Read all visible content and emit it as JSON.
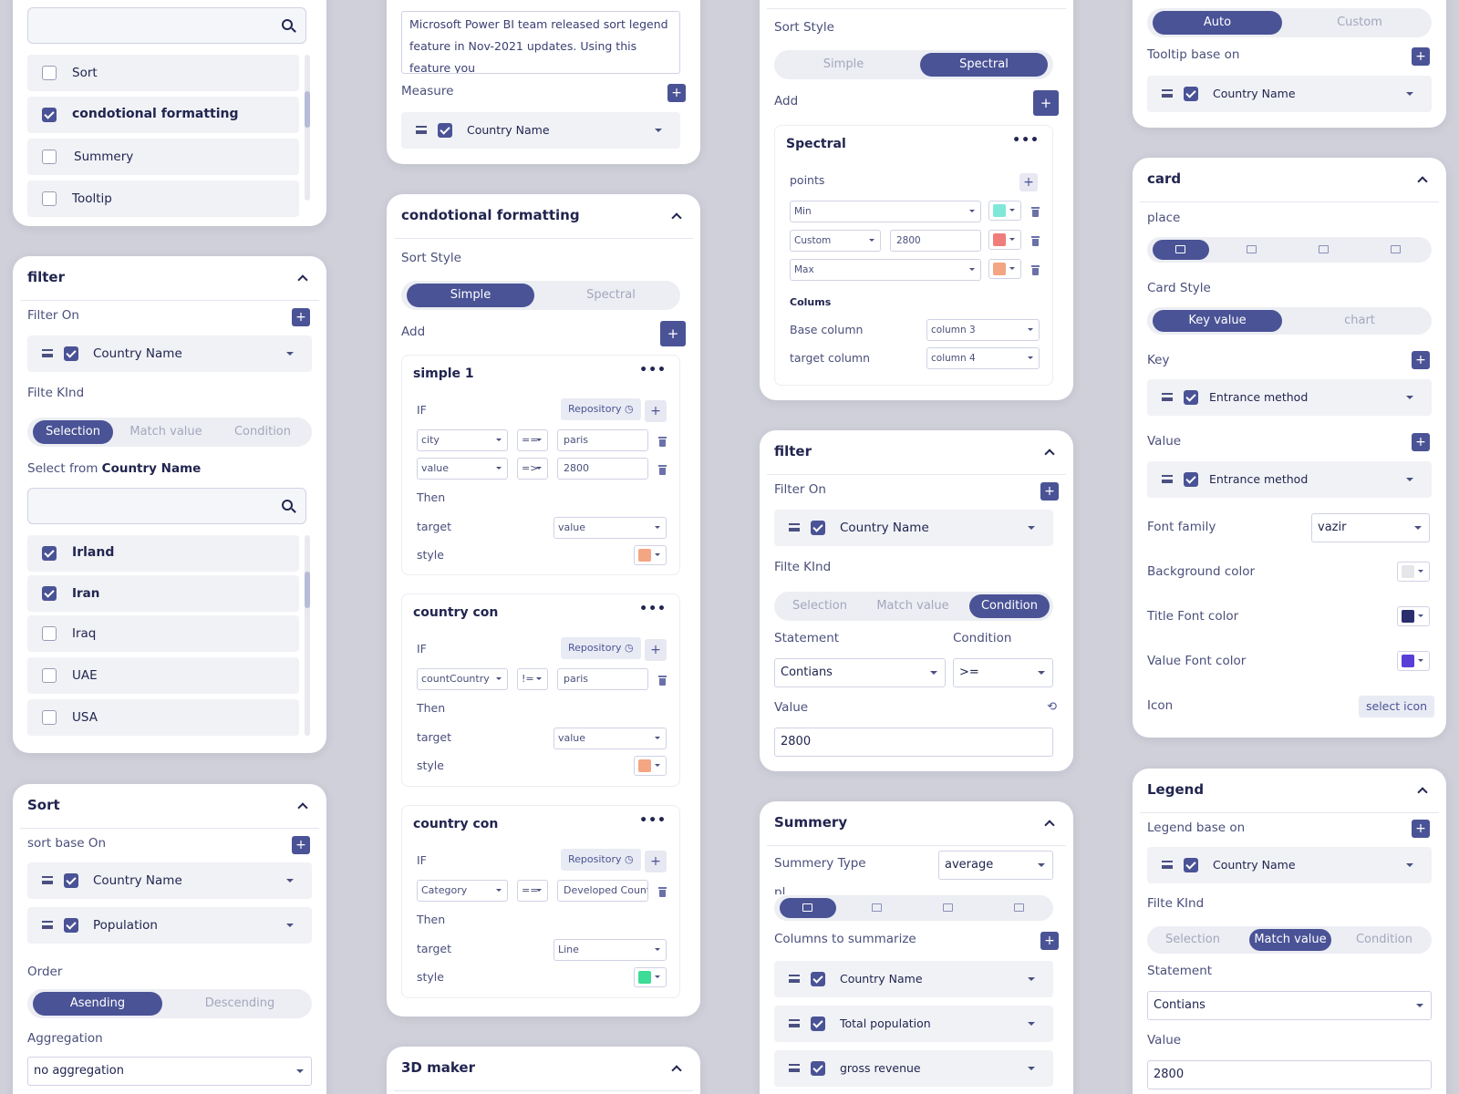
{
  "c1": {
    "search_placeholder": "",
    "items": [
      {
        "label": "Sort",
        "checked": false
      },
      {
        "label": "condotional formatting",
        "checked": true
      },
      {
        "label": "Summery",
        "checked": false
      },
      {
        "label": "Tooltip",
        "checked": false
      }
    ]
  },
  "c2": {
    "title": "filter",
    "filter_on": "Filter On",
    "field": "Country Name",
    "filte_kind": "Filte KInd",
    "kind_options": [
      "Selection",
      "Match value",
      "Condition"
    ],
    "select_from_prefix": "Select from ",
    "select_from_field": "Country Name",
    "search_placeholder": "",
    "countries": [
      {
        "label": "Irland",
        "checked": true
      },
      {
        "label": "Iran",
        "checked": true
      },
      {
        "label": "Iraq",
        "checked": false
      },
      {
        "label": "UAE",
        "checked": false
      },
      {
        "label": "USA",
        "checked": false
      }
    ]
  },
  "c3": {
    "title": "Sort",
    "sort_base": "sort base  On",
    "fields": [
      "Country Name",
      "Population"
    ],
    "order": "Order",
    "order_options": [
      "Asending",
      "Descending"
    ],
    "aggregation": "Aggregation",
    "aggregation_value": "no aggregation"
  },
  "c4": {
    "text": "Microsoft Power BI team released sort legend feature in Nov-2021 updates. Using this feature you",
    "measure": "Measure",
    "field": "Country Name"
  },
  "c5": {
    "title": "condotional formatting",
    "sort_style": "Sort Style",
    "style_options": [
      "Simple",
      "Spectral"
    ],
    "add": "Add",
    "if_label": "IF",
    "then_label": "Then",
    "target_label": "target",
    "style_label": "style",
    "repo_label": "Repository",
    "rules": [
      {
        "title": "simple 1",
        "conds": [
          {
            "field": "city",
            "op": "==",
            "val": "paris"
          },
          {
            "field": "value",
            "op": "=>",
            "val": "2800"
          }
        ],
        "target": "value",
        "color": "#f4a582"
      },
      {
        "title": "country con",
        "conds": [
          {
            "field": "countCountry",
            "op": "!=",
            "val": "paris"
          }
        ],
        "target": "value",
        "color": "#f4a582"
      },
      {
        "title": "country con",
        "conds": [
          {
            "field": "Category",
            "op": "==",
            "val": "Developed Countr"
          }
        ],
        "target": "Line",
        "color": "#3ddc97"
      }
    ]
  },
  "c6": {
    "title": "3D maker"
  },
  "c7": {
    "sort_style": "Sort Style",
    "style_options": [
      "Simple",
      "Spectral"
    ],
    "add": "Add",
    "spectral_title": "Spectral",
    "points": "points",
    "point_rows": [
      {
        "type": "Min",
        "value": "",
        "color": "#7fe8d8"
      },
      {
        "type": "Custom",
        "value": "2800",
        "color": "#f07c7c"
      },
      {
        "type": "Max",
        "value": "",
        "color": "#f4a582"
      }
    ],
    "colums": "Colums",
    "base_column": "Base column",
    "base_value": "column 3",
    "target_column": "target column",
    "target_value": "column 4"
  },
  "c8": {
    "title": "filter",
    "filter_on": "Filter On",
    "field": "Country Name",
    "filte_kind": "Filte KInd",
    "kind_options": [
      "Selection",
      "Match value",
      "Condition"
    ],
    "statement": "Statement",
    "condition": "Condition",
    "statement_value": "Contians",
    "condition_value": ">=",
    "value_label": "Value",
    "value": "2800"
  },
  "c9": {
    "title": "Summery",
    "summery_type": "Summery Type",
    "type_value": "average",
    "place_label": "pl",
    "columns_label": "Columns to summarize",
    "columns": [
      "Country Name",
      "Total population",
      "gross revenue"
    ]
  },
  "c10": {
    "mode_options": [
      "Auto",
      "Custom"
    ],
    "tooltip_base": "Tooltip base on",
    "field": "Country Name"
  },
  "c11": {
    "title": "card",
    "place": "place",
    "card_style": "Card Style",
    "style_options": [
      "Key value",
      "chart"
    ],
    "key": "Key",
    "key_field": "Entrance method",
    "value": "Value",
    "value_field": "Entrance method",
    "font_family": "Font family",
    "font_value": "vazir",
    "bg_color": "Background color",
    "bg_swatch": "#e6e6ea",
    "title_font_color": "Title Font color",
    "title_swatch": "#2a2e6e",
    "value_font_color": "Value Font color",
    "value_swatch": "#5a3fd6",
    "icon": "Icon",
    "select_icon": "select icon"
  },
  "c12": {
    "title": "Legend",
    "legend_base": "Legend base on",
    "field": "Country Name",
    "filte_kind": "Filte KInd",
    "kind_options": [
      "Selection",
      "Match value",
      "Condition"
    ],
    "statement": "Statement",
    "statement_value": "Contians",
    "value_label": "Value",
    "value": "2800"
  }
}
